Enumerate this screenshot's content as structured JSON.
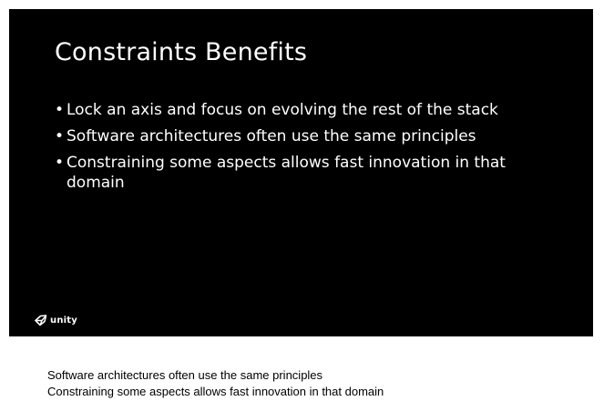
{
  "slide": {
    "title": "Constraints Benefits",
    "bullets": [
      "Lock an axis and focus on evolving the rest of the stack",
      "Software architectures often use the same principles",
      "Constraining some aspects allows fast innovation in that domain"
    ],
    "bullet_symbol": "•",
    "logo": {
      "icon": "unity-logo-icon",
      "text": "unity"
    },
    "background_color": "#000000",
    "text_color": "#ffffff"
  },
  "notes": {
    "lines": [
      "Software architectures often use the same principles",
      "Constraining some aspects allows fast innovation in that domain"
    ]
  }
}
